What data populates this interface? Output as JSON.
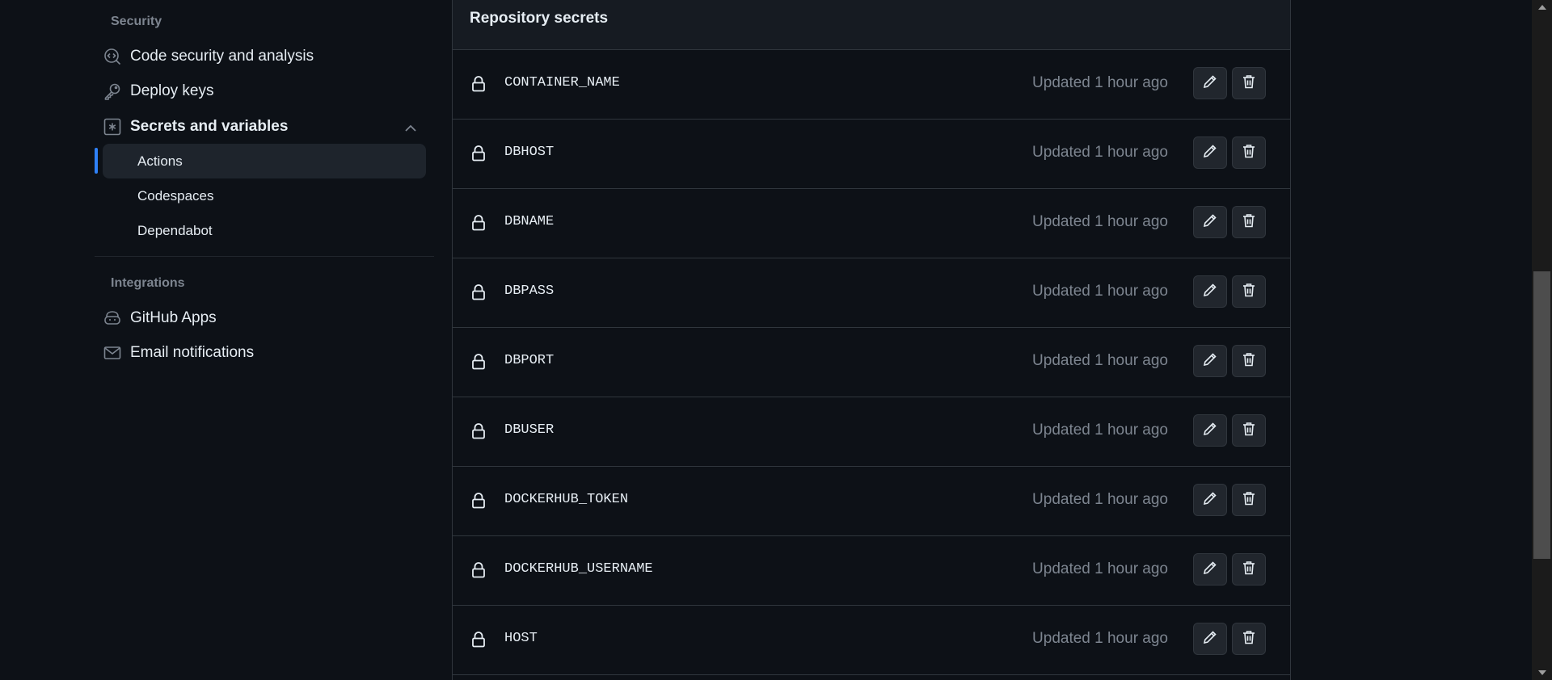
{
  "sidebar": {
    "security_heading": "Security",
    "code_security": "Code security and analysis",
    "deploy_keys": "Deploy keys",
    "secrets_and_variables": "Secrets and variables",
    "sub_items": {
      "actions": "Actions",
      "codespaces": "Codespaces",
      "dependabot": "Dependabot"
    },
    "integrations_heading": "Integrations",
    "github_apps": "GitHub Apps",
    "email_notifications": "Email notifications"
  },
  "panel": {
    "title": "Repository secrets"
  },
  "secrets": [
    {
      "name": "CONTAINER_NAME",
      "updated": "Updated 1 hour ago"
    },
    {
      "name": "DBHOST",
      "updated": "Updated 1 hour ago"
    },
    {
      "name": "DBNAME",
      "updated": "Updated 1 hour ago"
    },
    {
      "name": "DBPASS",
      "updated": "Updated 1 hour ago"
    },
    {
      "name": "DBPORT",
      "updated": "Updated 1 hour ago"
    },
    {
      "name": "DBUSER",
      "updated": "Updated 1 hour ago"
    },
    {
      "name": "DOCKERHUB_TOKEN",
      "updated": "Updated 1 hour ago"
    },
    {
      "name": "DOCKERHUB_USERNAME",
      "updated": "Updated 1 hour ago"
    },
    {
      "name": "HOST",
      "updated": "Updated 1 hour ago"
    }
  ],
  "icons": {
    "row_lock": "lock-icon",
    "row_edit": "pencil-icon",
    "row_delete": "trash-icon"
  },
  "colors": {
    "background": "#0d1117",
    "header_background": "#161b22",
    "border": "#30363d",
    "text": "#e6edf3",
    "muted_text": "#7d8590",
    "accent": "#2f81f7"
  }
}
